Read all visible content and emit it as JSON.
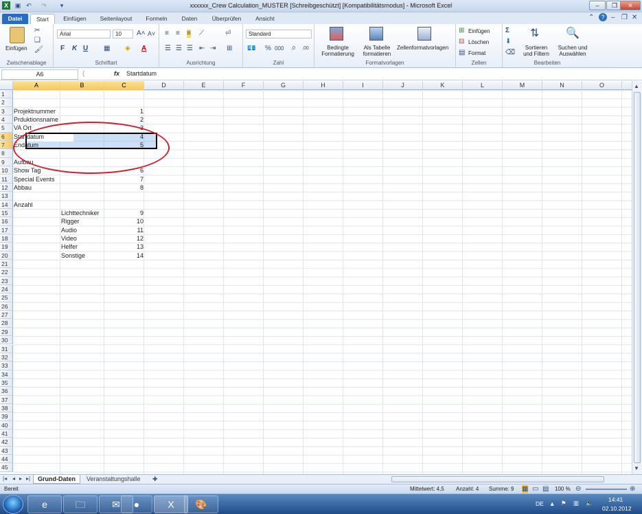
{
  "window": {
    "title": "xxxxxx_Crew Calculation_MUSTER [Schreibgeschützt] [Kompatibilitätsmodus] - Microsoft Excel"
  },
  "tabs": [
    "Datei",
    "Start",
    "Einfügen",
    "Seitenlayout",
    "Formeln",
    "Daten",
    "Überprüfen",
    "Ansicht"
  ],
  "ribbon": {
    "clipboard": {
      "paste": "Einfügen",
      "label": "Zwischenablage"
    },
    "font": {
      "name": "Arial",
      "size": "10",
      "bold": "F",
      "italic": "K",
      "underline": "U",
      "label": "Schriftart"
    },
    "alignment": {
      "label": "Ausrichtung"
    },
    "number": {
      "format": "Standard",
      "percent": "%",
      "thousands": "000",
      "label": "Zahl"
    },
    "styles": {
      "conditional": "Bedingte Formatierung",
      "table": "Als Tabelle formatieren",
      "cellstyles": "Zellenformatvorlagen",
      "label": "Formatvorlagen"
    },
    "cells": {
      "insert": "Einfügen",
      "delete": "Löschen",
      "format": "Format",
      "label": "Zellen"
    },
    "editing": {
      "sort": "Sortieren und Filtern",
      "find": "Suchen und Auswählen",
      "label": "Bearbeiten"
    }
  },
  "formula_bar": {
    "namebox": "A6",
    "fx": "fx",
    "content": "Startdatum"
  },
  "columns": [
    "A",
    "B",
    "C",
    "D",
    "E",
    "F",
    "G",
    "H",
    "I",
    "J",
    "K",
    "L",
    "M",
    "N",
    "O"
  ],
  "rows": [
    "1",
    "2",
    "3",
    "4",
    "5",
    "6",
    "7",
    "8",
    "9",
    "10",
    "11",
    "12",
    "13",
    "14",
    "15",
    "16",
    "17",
    "18",
    "19",
    "20",
    "21",
    "22",
    "23",
    "24",
    "25",
    "26",
    "27",
    "28",
    "29",
    "30",
    "31",
    "32",
    "33",
    "34",
    "35",
    "36",
    "37",
    "38",
    "39",
    "40",
    "41",
    "42",
    "43",
    "44",
    "45"
  ],
  "cells": [
    {
      "row": 3,
      "col": "A",
      "text": "Projektnummer"
    },
    {
      "row": 3,
      "col": "C",
      "text": "1"
    },
    {
      "row": 4,
      "col": "A",
      "text": "Prduktionsname"
    },
    {
      "row": 4,
      "col": "C",
      "text": "2"
    },
    {
      "row": 5,
      "col": "A",
      "text": "VA Ort"
    },
    {
      "row": 5,
      "col": "C",
      "text": "3"
    },
    {
      "row": 6,
      "col": "A",
      "text": "Startdatum"
    },
    {
      "row": 6,
      "col": "C",
      "text": "4"
    },
    {
      "row": 7,
      "col": "A",
      "text": "Endatum"
    },
    {
      "row": 7,
      "col": "C",
      "text": "5"
    },
    {
      "row": 9,
      "col": "A",
      "text": "Aufbau"
    },
    {
      "row": 10,
      "col": "A",
      "text": "Show Tag"
    },
    {
      "row": 10,
      "col": "C",
      "text": "6"
    },
    {
      "row": 11,
      "col": "A",
      "text": "Special Events"
    },
    {
      "row": 11,
      "col": "C",
      "text": "7"
    },
    {
      "row": 12,
      "col": "A",
      "text": "Abbau"
    },
    {
      "row": 12,
      "col": "C",
      "text": "8"
    },
    {
      "row": 14,
      "col": "A",
      "text": "Anzahl"
    },
    {
      "row": 15,
      "col": "B",
      "text": "Lichttechniker"
    },
    {
      "row": 15,
      "col": "C",
      "text": "9"
    },
    {
      "row": 16,
      "col": "B",
      "text": "Rigger"
    },
    {
      "row": 16,
      "col": "C",
      "text": "10"
    },
    {
      "row": 17,
      "col": "B",
      "text": "Audio"
    },
    {
      "row": 17,
      "col": "C",
      "text": "11"
    },
    {
      "row": 18,
      "col": "B",
      "text": "Video"
    },
    {
      "row": 18,
      "col": "C",
      "text": "12"
    },
    {
      "row": 19,
      "col": "B",
      "text": "Helfer"
    },
    {
      "row": 19,
      "col": "C",
      "text": "13"
    },
    {
      "row": 20,
      "col": "B",
      "text": "Sonstige"
    },
    {
      "row": 20,
      "col": "C",
      "text": "14"
    }
  ],
  "sheets": [
    "Grund-Daten",
    "Veranstaltungshalle"
  ],
  "status": {
    "ready": "Bereit",
    "average": "Mittelwert: 4,5",
    "count": "Anzahl: 4",
    "sum": "Summe: 9",
    "zoom": "100 %"
  },
  "taskbar": {
    "lang": "DE",
    "time": "14:41",
    "date": "02.10.2012"
  }
}
